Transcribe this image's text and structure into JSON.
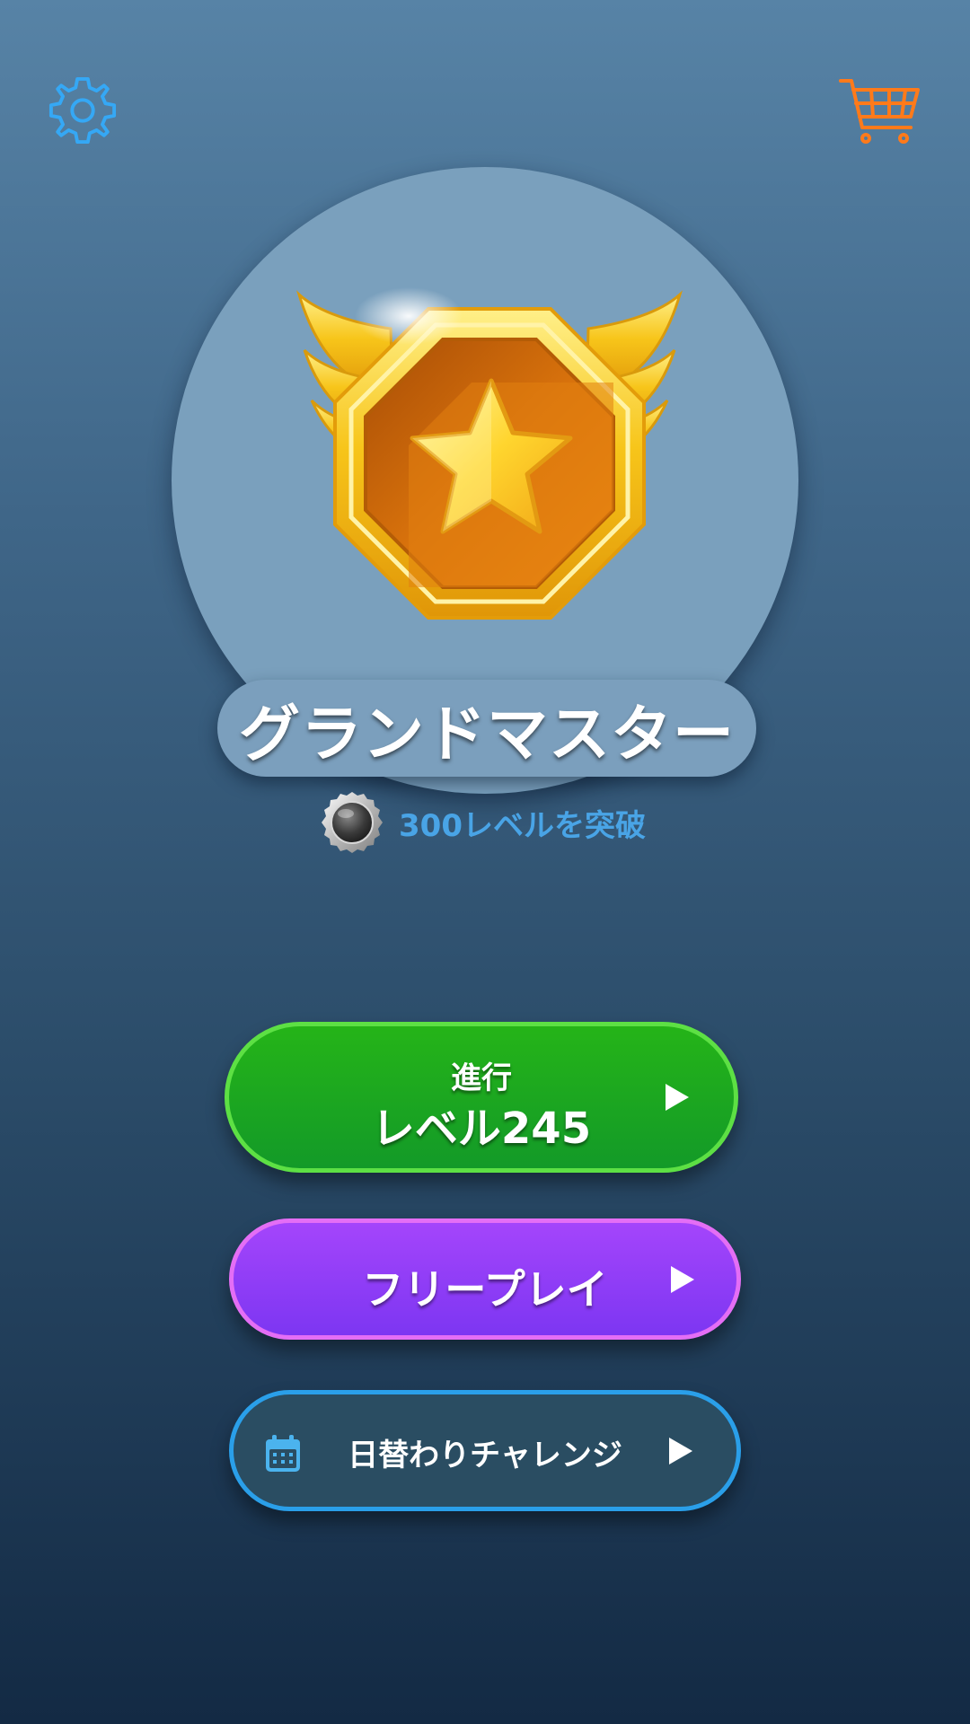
{
  "header": {
    "settings_icon": "gear-icon",
    "shop_icon": "shopping-cart-icon"
  },
  "rank": {
    "badge_icon": "winged-star-medal-icon",
    "title": "グランドマスター"
  },
  "achievement": {
    "icon": "silver-coin-icon",
    "text": "300レベルを突破"
  },
  "buttons": {
    "progress": {
      "label_top": "進行",
      "label_main": "レベル245",
      "icon": "play-icon"
    },
    "free_play": {
      "label": "フリープレイ",
      "icon": "play-icon"
    },
    "daily_challenge": {
      "label": "日替わりチャレンジ",
      "icon": "calendar-icon",
      "arrow_icon": "play-icon"
    }
  },
  "colors": {
    "settings_icon": "#35a8f5",
    "cart_icon": "#ff7a1a",
    "progress_button": "#1aa521",
    "free_play_button": "#8f3ef7",
    "daily_challenge_button": "#2a4d62",
    "achievement_text": "#49a4e6",
    "badge_gold": "#f5c518",
    "badge_orange": "#d9750a"
  }
}
